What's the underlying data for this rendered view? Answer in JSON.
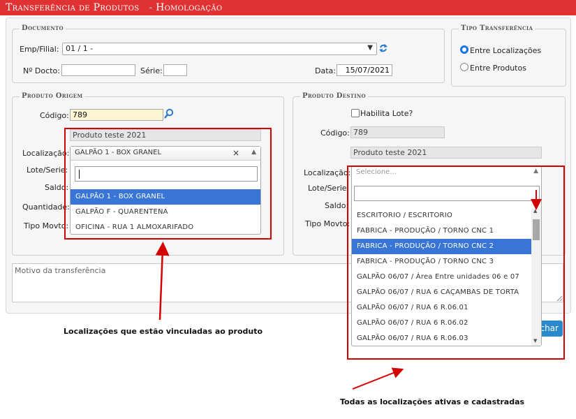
{
  "title": {
    "main": "Transferência de Produtos",
    "env": "- Homologação"
  },
  "documento": {
    "legend": "Documento",
    "emp_filial_label": "Emp/Filial:",
    "emp_filial_value": "01 / 1 -",
    "n_docto_label": "Nº Docto:",
    "serie_label": "Série:",
    "data_label": "Data:",
    "data_value": "15/07/2021"
  },
  "tipo": {
    "legend": "Tipo Transferência",
    "opt1": "Entre Localizações",
    "opt2": "Entre Produtos",
    "selected": "Entre Localizações"
  },
  "origem": {
    "legend": "Produto Origem",
    "codigo_label": "Código:",
    "codigo_value": "789",
    "descricao": "Produto teste 2021",
    "localizacao_label": "Localização:",
    "lote_label": "Lote/Serie:",
    "saldo_label": "Saldo:",
    "quantidade_label": "Quantidade:",
    "tipo_movto_label": "Tipo Movto:",
    "loc_selected": "GALPÃO 1 - BOX GRANEL",
    "loc_clear": "×",
    "options": [
      "GALPÃO 1 - BOX GRANEL",
      "GALPÃO F - QUARENTENA",
      "OFICINA - RUA 1 ALMOXARIFADO"
    ]
  },
  "destino": {
    "legend": "Produto Destino",
    "habilita_lote": "Habilita Lote?",
    "codigo_label": "Código:",
    "codigo_value": "789",
    "descricao": "Produto teste 2021",
    "localizacao_label": "Localização:",
    "lote_label": "Lote/Serie:",
    "saldo_label": "Saldo:",
    "tipo_movto_label": "Tipo Movto:",
    "placeholder": "Selecione...",
    "options": [
      "ESCRITORIO / ESCRITORIO",
      "FABRICA - PRODUÇÃO / TORNO CNC 1",
      "FABRICA - PRODUÇÃO / TORNO CNC 2",
      "FABRICA - PRODUÇÃO / TORNO CNC 3",
      "GALPÃO 06/07 / Área Entre unidades 06 e 07",
      "GALPÃO 06/07 / RUA 6 CAÇAMBAS DE TORTA",
      "GALPÃO 06/07 / RUA 6 R.06.01",
      "GALPÃO 06/07 / RUA 6 R.06.02",
      "GALPÃO 06/07 / RUA 6 R.06.03"
    ],
    "selected_index": 2
  },
  "motivo": {
    "placeholder": "Motivo da transferência"
  },
  "button": {
    "label": "char"
  },
  "annotations": {
    "left_note": "Localizações que estão vinculadas ao produto",
    "right_note": "Todas as localizações ativas e cadastradas",
    "color": "#d40000"
  },
  "colors": {
    "title_bar": "#e03232",
    "selected": "#3875d7",
    "button": "#2a89cc"
  }
}
